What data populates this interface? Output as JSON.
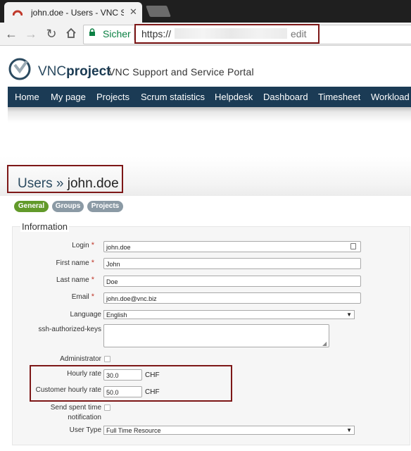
{
  "browser": {
    "tab_title": "john.doe - Users - VNC S",
    "secure_label": "Sicher",
    "url_prefix": "https://",
    "url_suffix": "edit"
  },
  "site": {
    "logo_text_plain": "VNC",
    "logo_text_bold": "project",
    "subtitle": "VNC Support and Service Portal"
  },
  "topnav": [
    "Home",
    "My page",
    "Projects",
    "Scrum statistics",
    "Helpdesk",
    "Dashboard",
    "Timesheet",
    "Workload"
  ],
  "page": {
    "title_section": "Users",
    "title_separator": "»",
    "title_user": "john.doe"
  },
  "tabs": [
    "General",
    "Groups",
    "Projects"
  ],
  "form": {
    "legend": "Information",
    "login": {
      "label": "Login",
      "value": "john.doe"
    },
    "firstname": {
      "label": "First name",
      "value": "John"
    },
    "lastname": {
      "label": "Last name",
      "value": "Doe"
    },
    "email": {
      "label": "Email",
      "value": "john.doe@vnc.biz"
    },
    "language": {
      "label": "Language",
      "value": "English"
    },
    "ssh_keys": {
      "label": "ssh-authorized-keys",
      "value": ""
    },
    "administrator": {
      "label": "Administrator",
      "checked": false
    },
    "hourly_rate": {
      "label": "Hourly rate",
      "value": "30.0",
      "unit": "CHF"
    },
    "customer_hourly_rate": {
      "label": "Customer hourly rate",
      "value": "50.0",
      "unit": "CHF"
    },
    "send_spent_time": {
      "label_line1": "Send spent time",
      "label_line2": "notification",
      "checked": false
    },
    "user_type": {
      "label": "User Type",
      "value": "Full Time Resource"
    }
  },
  "colors": {
    "nav_bg": "#1b3b55",
    "tab_active": "#629a2a",
    "tab_inactive": "#8b9aa5",
    "highlight": "#7d1717",
    "required": "#c0392b"
  }
}
